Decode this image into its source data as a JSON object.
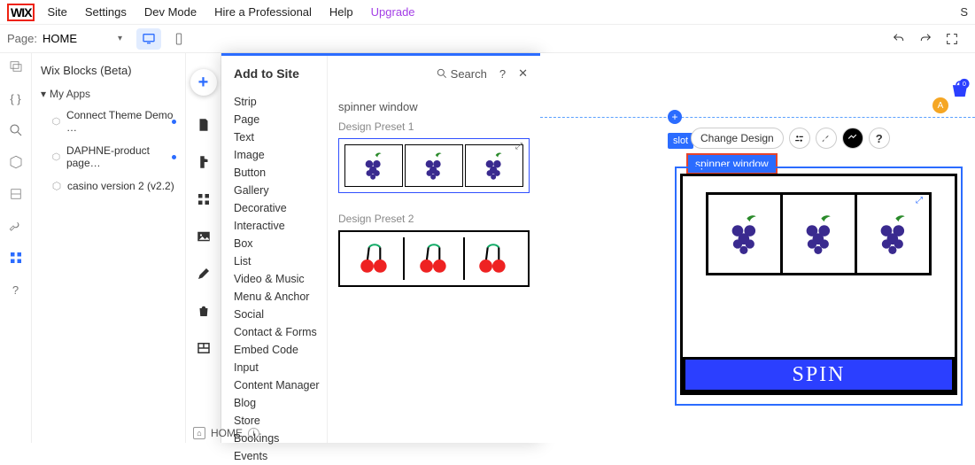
{
  "topbar": {
    "logo": "WIX",
    "menu": [
      "Site",
      "Settings",
      "Dev Mode",
      "Hire a Professional",
      "Help"
    ],
    "upgrade": "Upgrade",
    "right": "S"
  },
  "subbar": {
    "page_label": "Page:",
    "page_value": "HOME"
  },
  "explorer": {
    "header": "Wix Blocks (Beta)",
    "group": "My Apps",
    "items": [
      {
        "label": "Connect Theme Demo …",
        "dot": true
      },
      {
        "label": "DAPHNE-product page…",
        "dot": true
      },
      {
        "label": "casino version 2 (v2.2)",
        "dot": false
      }
    ]
  },
  "flyout": {
    "title": "Add to Site",
    "search": "Search",
    "categories": [
      "Strip",
      "Page",
      "Text",
      "Image",
      "Button",
      "Gallery",
      "Decorative",
      "Interactive",
      "Box",
      "List",
      "Video & Music",
      "Menu & Anchor",
      "Social",
      "Contact & Forms",
      "Embed Code",
      "Input",
      "Content Manager",
      "Blog",
      "Store",
      "Bookings",
      "Events"
    ],
    "section_title": "spinner window",
    "preset1": "Design Preset 1",
    "preset2": "Design Preset 2"
  },
  "canvas": {
    "avatar": "A",
    "cart_count": "0",
    "slot_tag": "slot",
    "change_design": "Change Design",
    "selected_label": "spinner window",
    "spin": "SPIN"
  },
  "bottom": {
    "page": "HOME"
  }
}
